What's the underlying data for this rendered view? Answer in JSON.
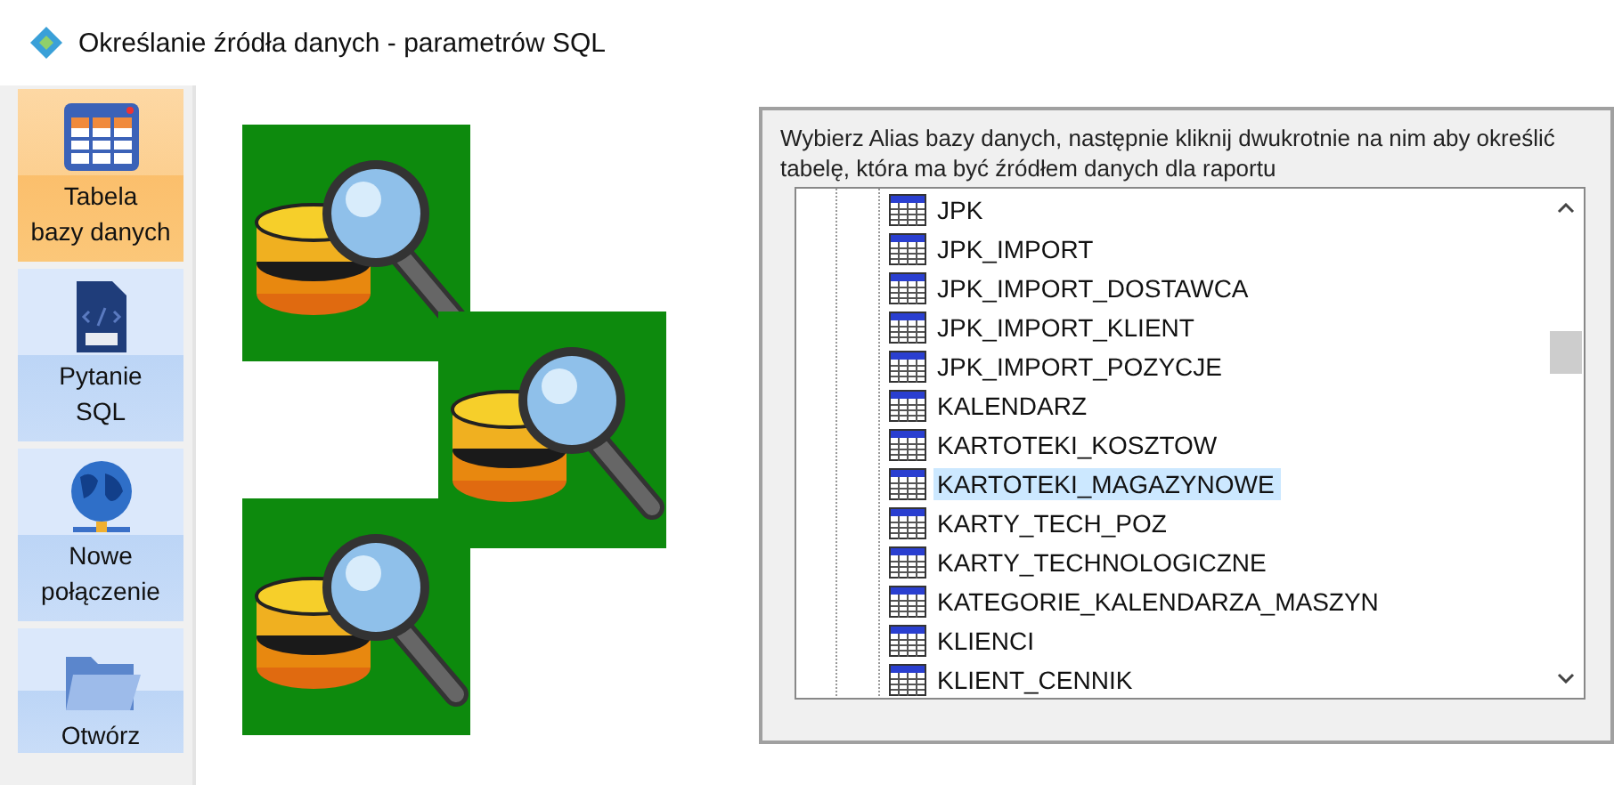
{
  "window": {
    "title": "Określanie źródła danych - parametrów SQL"
  },
  "sidebar": {
    "items": [
      {
        "label": "Tabela\nbazy danych",
        "selected": true
      },
      {
        "label": "Pytanie\nSQL",
        "selected": false
      },
      {
        "label": "Nowe\npołączenie",
        "selected": false
      },
      {
        "label": "Otwórz",
        "selected": false
      }
    ]
  },
  "panel": {
    "instruction": "Wybierz Alias bazy danych, następnie kliknij dwukrotnie na nim aby określić tabelę,  która ma być źródłem danych dla raportu",
    "tree": [
      {
        "label": "JPK",
        "selected": false
      },
      {
        "label": "JPK_IMPORT",
        "selected": false
      },
      {
        "label": "JPK_IMPORT_DOSTAWCA",
        "selected": false
      },
      {
        "label": "JPK_IMPORT_KLIENT",
        "selected": false
      },
      {
        "label": "JPK_IMPORT_POZYCJE",
        "selected": false
      },
      {
        "label": "KALENDARZ",
        "selected": false
      },
      {
        "label": "KARTOTEKI_KOSZTOW",
        "selected": false
      },
      {
        "label": "KARTOTEKI_MAGAZYNOWE",
        "selected": true
      },
      {
        "label": "KARTY_TECH_POZ",
        "selected": false
      },
      {
        "label": "KARTY_TECHNOLOGICZNE",
        "selected": false
      },
      {
        "label": "KATEGORIE_KALENDARZA_MASZYN",
        "selected": false
      },
      {
        "label": "KLIENCI",
        "selected": false
      },
      {
        "label": "KLIENT_CENNIK",
        "selected": false
      }
    ]
  }
}
